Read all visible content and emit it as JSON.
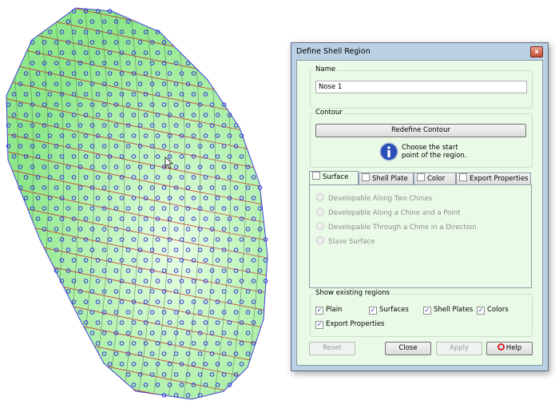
{
  "viewport": {
    "surface_color": "#a8f0a0",
    "point_color": "#3030e0",
    "line_color": "#d02020"
  },
  "dialog": {
    "title": "Define Shell Region",
    "close_icon": "close-icon",
    "name_group": {
      "label": "Name",
      "value": "Nose 1"
    },
    "contour_group": {
      "label": "Contour",
      "button": "Redefine Contour",
      "info_icon": "info-icon",
      "info_text_1": "Choose the start",
      "info_text_2": "point of the region."
    },
    "tabs": [
      {
        "label": "Surface",
        "checked": false,
        "active": true
      },
      {
        "label": "Shell Plate",
        "checked": false
      },
      {
        "label": "Color",
        "checked": false
      },
      {
        "label": "Export Properties",
        "checked": false
      }
    ],
    "surface_options": [
      "Developable Along Two Chines",
      "Developable Along a Chine and a Point",
      "Developable Through a Chine in a Direction",
      "Slave Surface"
    ],
    "show_group": {
      "label": "Show existing regions",
      "items": [
        {
          "label": "Plain",
          "checked": true
        },
        {
          "label": "Surfaces",
          "checked": true
        },
        {
          "label": "Shell Plates",
          "checked": true
        },
        {
          "label": "Colors",
          "checked": true
        },
        {
          "label": "Export Properties",
          "checked": true
        }
      ]
    },
    "buttons": {
      "reset": "Reset",
      "close": "Close",
      "apply": "Apply",
      "help": "Help"
    }
  }
}
